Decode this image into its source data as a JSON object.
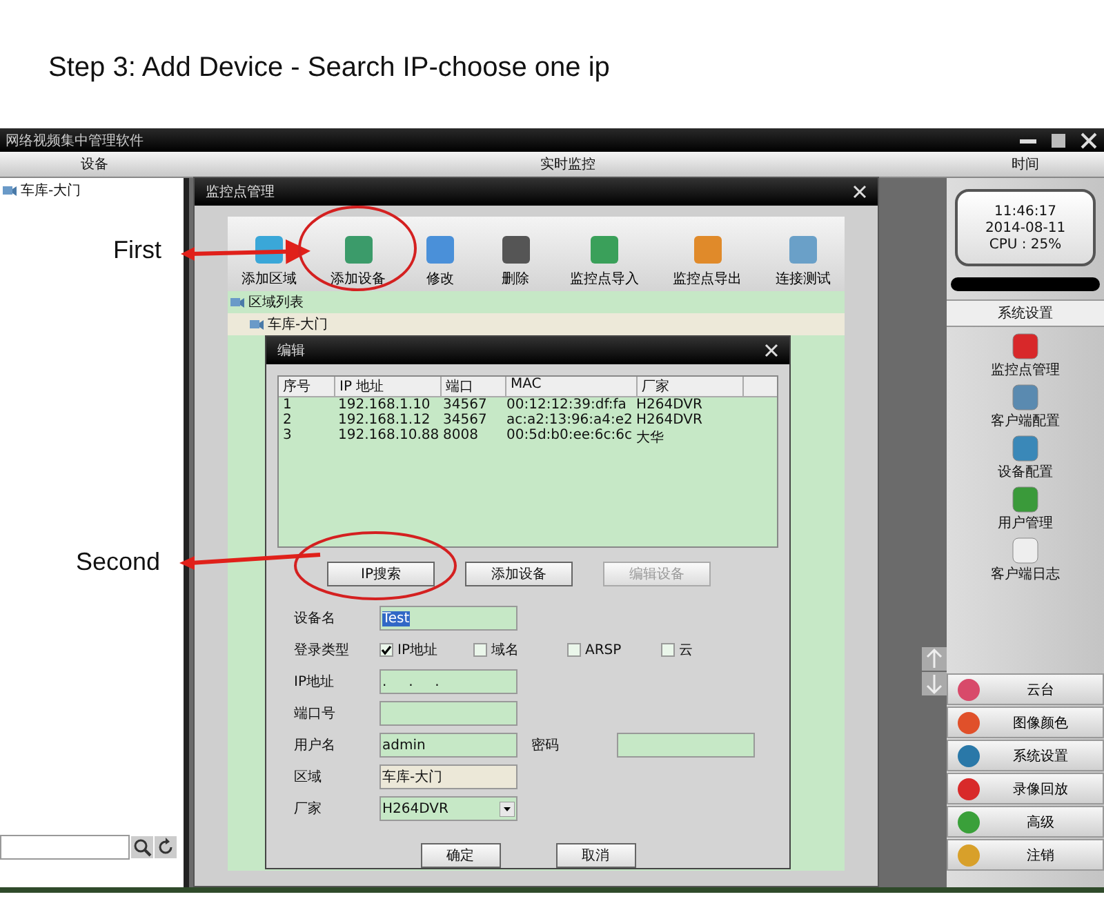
{
  "caption": "Step 3: Add Device - Search IP-choose one ip",
  "app": {
    "title": "网络视频集中管理软件",
    "columns": [
      "设备",
      "实时监控",
      "时间"
    ],
    "tree": [
      {
        "label": "车库-大门"
      }
    ],
    "clock": [
      "11:46:17",
      "2014-08-11",
      "CPU : 25%"
    ],
    "side_header": "系统设置",
    "side_items": [
      "监控点管理",
      "客户端配置",
      "设备配置",
      "用户管理",
      "客户端日志"
    ],
    "bottom_buttons": [
      "云台",
      "图像颜色",
      "系统设置",
      "录像回放",
      "高级",
      "注销"
    ]
  },
  "manager": {
    "title": "监控点管理",
    "toolbar": [
      "添加区域",
      "添加设备",
      "修改",
      "删除",
      "监控点导入",
      "监控点导出",
      "连接测试"
    ],
    "tree": [
      {
        "label": "区域列表",
        "children": [
          {
            "label": "车库-大门"
          }
        ]
      }
    ]
  },
  "editor": {
    "title": "编辑",
    "list": {
      "columns": [
        "序号",
        "IP 地址",
        "端口",
        "MAC",
        "厂家"
      ],
      "rows": [
        [
          "1",
          "192.168.1.10",
          "34567",
          "00:12:12:39:df:fa",
          "H264DVR"
        ],
        [
          "2",
          "192.168.1.12",
          "34567",
          "ac:a2:13:96:a4:e2",
          "H264DVR"
        ],
        [
          "3",
          "192.168.10.88",
          "8008",
          "00:5d:b0:ee:6c:6c",
          "大华"
        ]
      ]
    },
    "buttons": [
      {
        "label": "IP搜索",
        "disabled": false
      },
      {
        "label": "添加设备",
        "disabled": false
      },
      {
        "label": "编辑设备",
        "disabled": true
      }
    ],
    "form": [
      {
        "kind": "text",
        "label": "设备名",
        "value": "Test",
        "highlighted": true
      },
      {
        "kind": "checks",
        "label": "登录类型",
        "options": [
          {
            "label": "IP地址",
            "checked": true
          },
          {
            "label": "域名",
            "checked": false
          },
          {
            "label": "ARSP",
            "checked": false
          },
          {
            "label": "云",
            "checked": false
          }
        ]
      },
      {
        "kind": "text",
        "label": "IP地址",
        "value": ".     .     ."
      },
      {
        "kind": "text",
        "label": "端口号"
      },
      {
        "kind": "pair",
        "label": "用户名",
        "value": "admin",
        "label2": "密码"
      },
      {
        "kind": "text",
        "label": "区域",
        "value": "车库-大门",
        "readonly": true
      },
      {
        "kind": "select",
        "label": "厂家",
        "value": "H264DVR"
      }
    ],
    "footer": [
      "确定",
      "取消"
    ]
  },
  "annotations": [
    {
      "label": "First"
    },
    {
      "label": "Second"
    }
  ]
}
